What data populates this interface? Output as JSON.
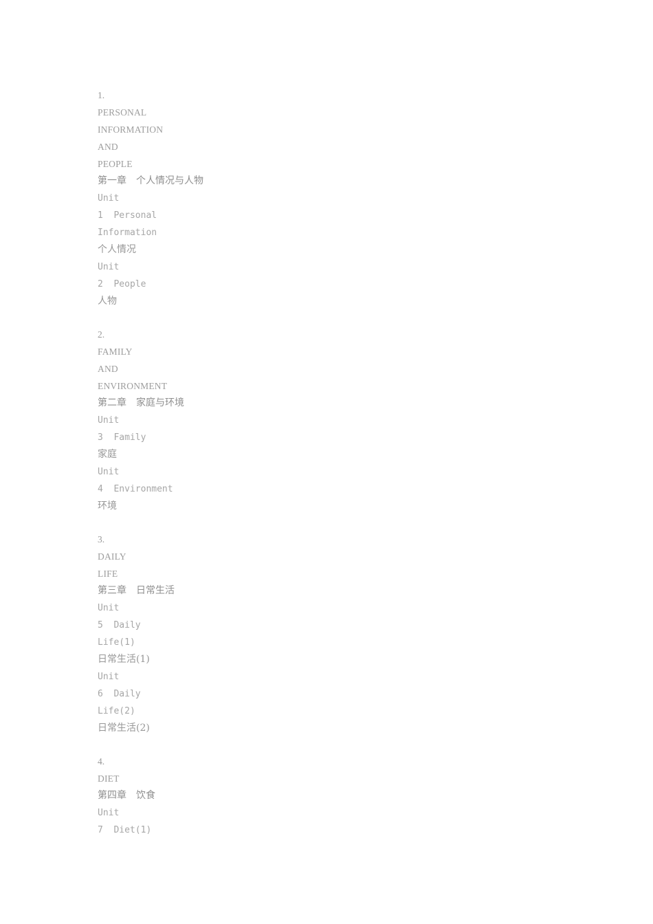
{
  "document": {
    "background_color": "#ffffff",
    "text_color": "#9a9a9a"
  },
  "toc": {
    "chapters": [
      {
        "number": "1.",
        "en_title_lines": [
          "PERSONAL",
          "INFORMATION",
          "AND",
          "PEOPLE"
        ],
        "cn_title": "第一章　个人情况与人物",
        "units": [
          {
            "label_lines": [
              "Unit",
              "1  Personal",
              "Information"
            ],
            "cn_label": "个人情况"
          },
          {
            "label_lines": [
              "Unit",
              "2  People"
            ],
            "cn_label": "人物"
          }
        ]
      },
      {
        "number": "2.",
        "en_title_lines": [
          "FAMILY",
          "AND",
          "ENVIRONMENT"
        ],
        "cn_title": "第二章　家庭与环境",
        "units": [
          {
            "label_lines": [
              "Unit",
              "3  Family"
            ],
            "cn_label": "家庭"
          },
          {
            "label_lines": [
              "Unit",
              "4  Environment"
            ],
            "cn_label": "环境"
          }
        ]
      },
      {
        "number": "3.",
        "en_title_lines": [
          "DAILY",
          "LIFE"
        ],
        "cn_title": "第三章　日常生活",
        "units": [
          {
            "label_lines": [
              "Unit",
              "5  Daily",
              "Life(1)"
            ],
            "cn_label": "日常生活(1)"
          },
          {
            "label_lines": [
              "Unit",
              "6  Daily",
              "Life(2)"
            ],
            "cn_label": "日常生活(2)"
          }
        ]
      },
      {
        "number": "4.",
        "en_title_lines": [
          "DIET"
        ],
        "cn_title": "第四章　饮食",
        "units": [
          {
            "label_lines": [
              "Unit",
              "7  Diet(1)"
            ],
            "cn_label": ""
          }
        ]
      }
    ]
  }
}
